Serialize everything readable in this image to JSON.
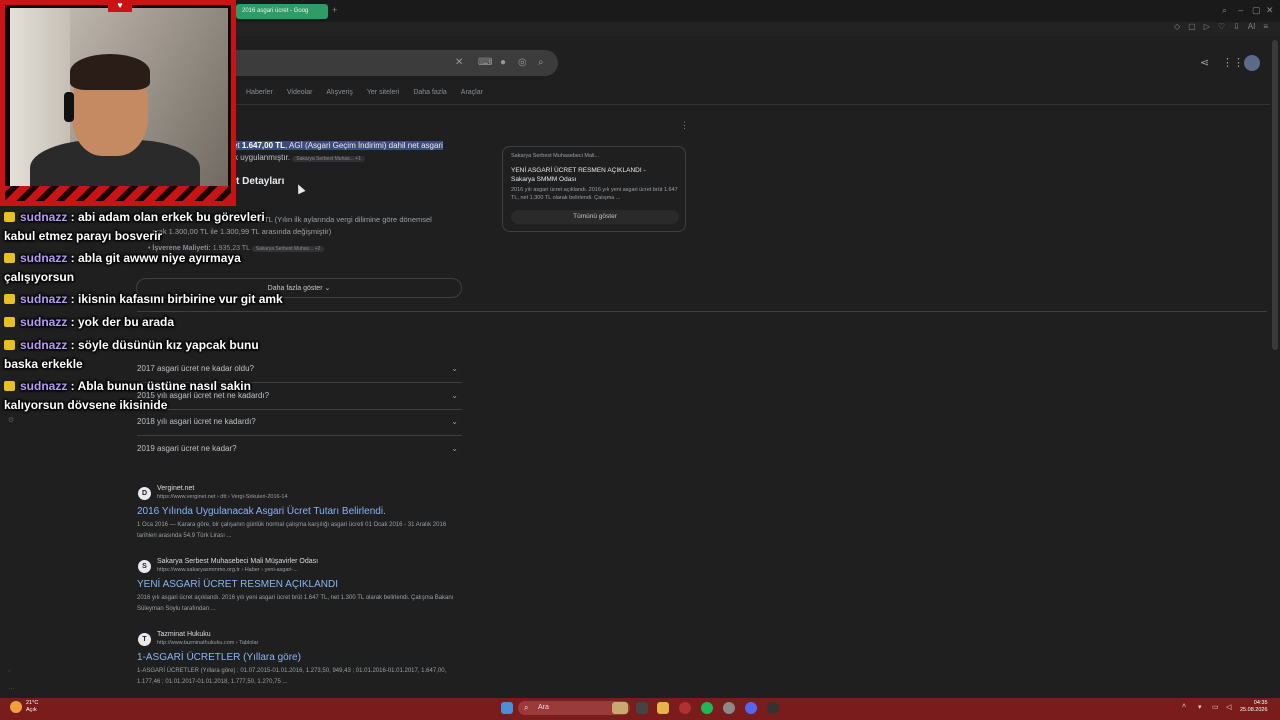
{
  "browser": {
    "tab_title": "2016 asgari ücret - Goog",
    "tab_add": "+",
    "toolbar_user": "AI"
  },
  "search": {
    "nav_tabs": [
      "Haberler",
      "Videolar",
      "Alışveriş",
      "Yer siteleri",
      "Daha fazla",
      "Araçlar"
    ]
  },
  "snippet": {
    "line1_hl_pre": "et ",
    "line1_hl_bold": "1.647,00 TL",
    "line1_hl_post": ", AGİ (Asgari Geçim İndirimi) dahil net asgari",
    "line2": "k uygulanmıştır.",
    "line2_chip": "Sakarya Serbest Muhas... +1",
    "section_title": "t Detayları",
    "detail_line1": "9 TL (Yılın ilk aylarında vergi dilimine göre dönemsel",
    "detail_line2": "arak 1.300,00 TL ile 1.300,99 TL arasında değişmiştir)",
    "employer_label": "İşverene Maliyeti:",
    "employer_value": "1.935,23 TL",
    "employer_chip": "Sakarya Serbest Muhas... +2",
    "more_button": "Daha fazla göster"
  },
  "side_card": {
    "source": "Sakarya Serbest Muhasebeci Mali...",
    "title": "YENİ ASGARİ ÜCRET RESMEN AÇIKLANDI - Sakarya SMMM Odası",
    "text": "2016 yılı asgari ücret açıklandı. 2016 yılı yeni asgari ücret brüt 1.647 TL, net 1.300 TL olarak belirlendi. Çalışma ...",
    "button": "Tümünü göster"
  },
  "faq": [
    "2017 asgari ücret ne kadar oldu?",
    "2015 yılı asgari ücret net ne kadardı?",
    "2018 yılı asgari ücret ne kadardı?",
    "2019 asgari ücret ne kadar?"
  ],
  "results": [
    {
      "fav": "D",
      "site": "Verginet.net",
      "url": "https://www.verginet.net › dtt › Vergi-Sirkuleri-2016-14",
      "title": "2016 Yılında Uygulanacak Asgari Ücret Tutarı Belirlendi.",
      "desc": "1 Oca 2016 — Karara göre, bir çalışanın günlük normal çalışma karşılığı asgari ücreti 01 Ocak 2016 - 31 Aralık 2016 tarihleri arasında 54,9 Türk Lirası ..."
    },
    {
      "fav": "S",
      "site": "Sakarya Serbest Muhasebeci Mali Müşavirler Odası",
      "url": "https://www.sakaryasmmmo.org.tr › Haber › yeni-asgari-...",
      "title": "YENİ ASGARİ ÜCRET RESMEN AÇIKLANDI",
      "desc": "2016 yılı asgari ücret açıklandı. 2016 yılı yeni asgari ücret brüt 1.647 TL, net 1.300 TL olarak belirlendi. Çalışma Bakanı Süleyman Soylu tarafından ..."
    },
    {
      "fav": "T",
      "site": "Tazminat Hukuku",
      "url": "http://www.tazminathukuku.com › Tablolar",
      "title": "1-ASGARİ ÜCRETLER (Yıllara göre)",
      "desc": "1-ASGARİ ÜCRETLER (Yıllara göre) ; 01.07.2015-01.01.2016, 1.273,50, 949,43 ; 01.01.2016-01.01.2017, 1.647,00, 1.177,46 ; 01.01.2017-01.01.2018, 1.777,50, 1.270,75 ..."
    }
  ],
  "chat": [
    {
      "user": "sudnazz",
      "msg": " : abi adam olan erkek bu görevleri",
      "cont": "kabul etmez parayı bosverir"
    },
    {
      "user": "sudnazz",
      "msg": " : abla git awww niye ayırmaya",
      "cont": "çalışıyorsun"
    },
    {
      "user": "sudnazz",
      "msg": " : ikisnin kafasını birbirine vur git amk",
      "cont": ""
    },
    {
      "user": "sudnazz",
      "msg": " : yok der bu arada",
      "cont": ""
    },
    {
      "user": "sudnazz",
      "msg": " : söyle düsünün kız yapcak bunu",
      "cont": "baska erkekle"
    },
    {
      "user": "sudnazz",
      "msg": " : Abla bunun üstüne nasıl sakin",
      "cont": "kalıyorsun dövsene ikisinide"
    }
  ],
  "taskbar": {
    "weather_temp": "21°C",
    "weather_desc": "Açık",
    "search_label": "Ara",
    "time": "04:35",
    "date": "25.08.2026"
  }
}
